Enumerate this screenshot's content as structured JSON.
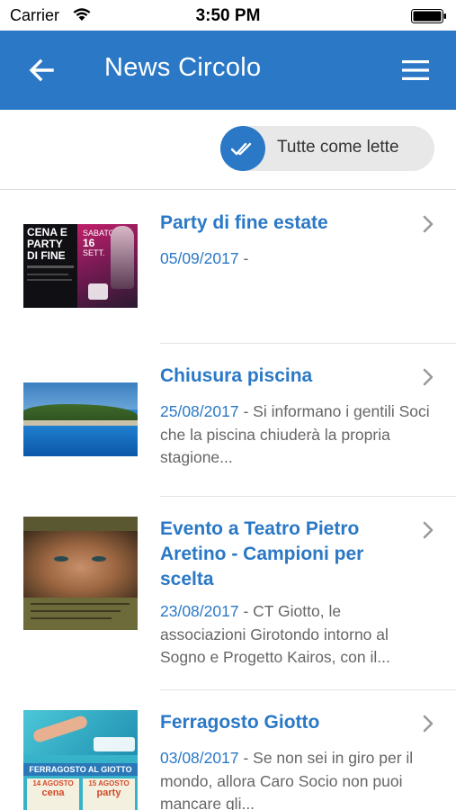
{
  "status_bar": {
    "carrier": "Carrier",
    "time": "3:50 PM"
  },
  "navbar": {
    "title": "News Circolo",
    "back_icon": "back-arrow-icon",
    "menu_icon": "hamburger-menu-icon"
  },
  "toolbar": {
    "mark_all_read_label": "Tutte come lette",
    "icon": "double-check-icon"
  },
  "colors": {
    "accent": "#2a78c6",
    "muted_text": "#666666",
    "divider": "#e3e3e3"
  },
  "news": [
    {
      "title": "Party di fine estate",
      "date": "05/09/2017",
      "separator": " - ",
      "excerpt": ""
    },
    {
      "title": "Chiusura piscina",
      "date": "25/08/2017",
      "separator": " - ",
      "excerpt": "Si informano i gentili Soci che la piscina chiuderà la propria stagione..."
    },
    {
      "title": "Evento a Teatro Pietro Aretino - Campioni per scelta",
      "date": "23/08/2017",
      "separator": " - ",
      "excerpt": "CT Giotto, le associazioni Girotondo intorno al Sogno e Progetto Kairos, con il..."
    },
    {
      "title": "Ferragosto Giotto",
      "date": "03/08/2017",
      "separator": " - ",
      "excerpt": "Se non sei in giro per il mondo, allora Caro Socio non puoi mancare gli..."
    }
  ],
  "thumbnails": {
    "party": {
      "line1": "CENA E",
      "line2": "PARTY",
      "line3": "DI FINE",
      "day": "SABATO",
      "date": "16",
      "month": "SETT."
    },
    "ferragosto": {
      "banner": "FERRAGOSTO AL GIOTTO",
      "left_date": "14 AGOSTO",
      "left_event": "cena",
      "right_date": "15 AGOSTO",
      "right_event": "party"
    }
  }
}
